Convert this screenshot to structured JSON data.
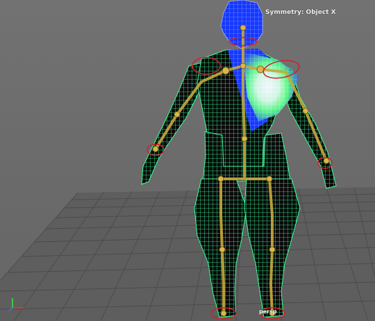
{
  "viewport": {
    "symmetry_label": "Symmetry: Object X",
    "camera_label": "persp"
  },
  "axis": {
    "y_label": "Y",
    "x_label": "X"
  },
  "colors": {
    "background": "#6e6e6e",
    "grid": "#4a4a4a",
    "wire_green": "#3dff9e",
    "wire_blue": "#1a3cff",
    "skin_dark": "#0a0a0a",
    "bone": "#c7a93c",
    "joint_ring": "#d01f2c",
    "axis_x": "#e83a3a",
    "axis_y": "#3ae83a",
    "axis_z": "#3a78ff"
  },
  "icons": {
    "axis_gizmo": "axis-gizmo-icon",
    "character_mesh": "rigged-character-wireframe"
  }
}
